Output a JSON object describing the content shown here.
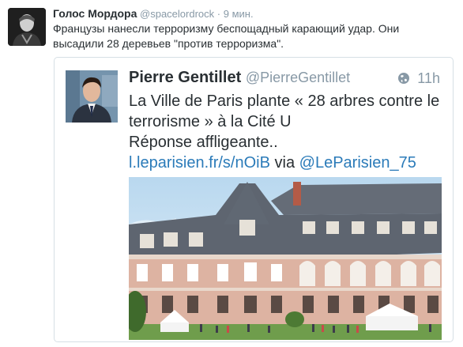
{
  "tweet": {
    "author_name": "Голос Мордора",
    "author_handle": "@spacelordrock",
    "separator": "·",
    "time": "9 мин.",
    "text": "Французы нанесли терроризму беспощадный карающий удар. Они высадили 28 деревьев \"против терроризма\"."
  },
  "quoted": {
    "author_name": "Pierre Gentillet",
    "author_handle": "@PierreGentillet",
    "time": "11h",
    "line1": "La Ville de Paris plante « 28 arbres contre le terrorisme » à la Cité U",
    "line2": "Réponse affligeante..",
    "link": "l.leparisien.fr/s/nOiB",
    "via": "via",
    "mention": "@LeParisien_75",
    "globe_icon": "globe-icon"
  },
  "colors": {
    "link": "#2b7bb9",
    "muted": "#8899a6",
    "text": "#292f33",
    "border": "#d6dfe5"
  }
}
